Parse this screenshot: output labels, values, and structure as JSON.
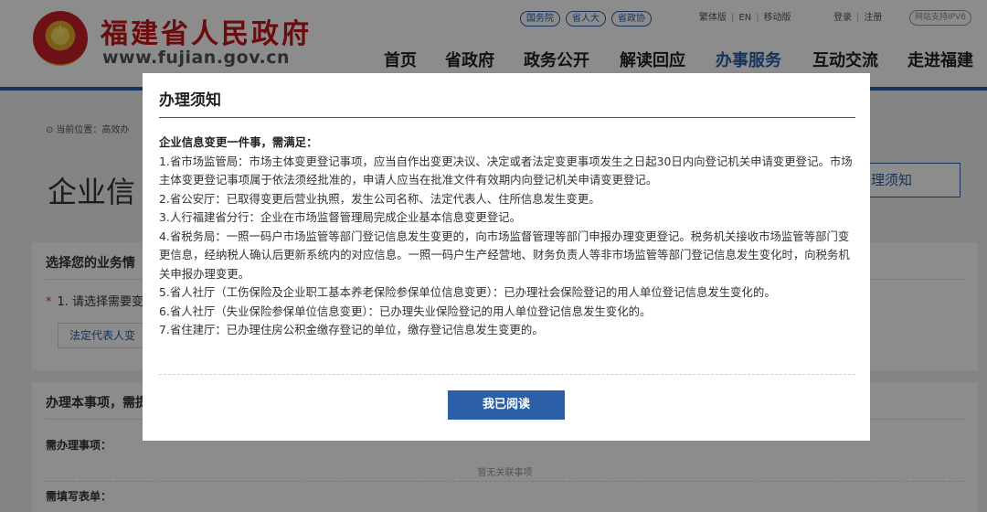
{
  "header": {
    "site_name": "福建省人民政府",
    "site_url": "www.fujian.gov.cn",
    "top_links": [
      "国务院",
      "省人大",
      "省政协"
    ],
    "utility_links": [
      "繁体版",
      "EN",
      "移动版"
    ],
    "account_links": [
      "登录",
      "注册"
    ],
    "ipv6_badge": "网站支持IPV6",
    "nav": [
      "首页",
      "省政府",
      "政务公开",
      "解读回应",
      "办事服务",
      "互动交流",
      "走进福建"
    ],
    "active_nav": "办事服务",
    "brand_color": "#2b5fa8",
    "title_color": "#c4161c"
  },
  "page": {
    "breadcrumb": "当前位置：高效办",
    "title": "企业信",
    "notice_button": "理须知",
    "panel1": {
      "heading": "选择您的业务情",
      "question": "1. 请选择需要变",
      "option": "法定代表人变"
    },
    "panel2": {
      "heading": "办理本事项，需提",
      "items_label": "需办理事项：",
      "empty_text": "暂无关联事项",
      "forms_label": "需填写表单："
    }
  },
  "modal": {
    "title": "办理须知",
    "lead": "企业信息变更一件事，需满足：",
    "items": [
      "1.省市场监管局：市场主体变更登记事项，应当自作出变更决议、决定或者法定变更事项发生之日起30日内向登记机关申请变更登记。市场主体变更登记事项属于依法须经批准的，申请人应当在批准文件有效期内向登记机关申请变更登记。",
      "2.省公安厅：已取得变更后营业执照，发生公司名称、法定代表人、住所信息发生变更。",
      "3.人行福建省分行：企业在市场监督管理局完成企业基本信息变更登记。",
      "4.省税务局：一照一码户市场监管等部门登记信息发生变更的，向市场监督管理等部门申报办理变更登记。税务机关接收市场监管等部门变更信息，经纳税人确认后更新系统内的对应信息。一照一码户生产经营地、财务负责人等非市场监管等部门登记信息发生变化时，向税务机关申报办理变更。",
      "5.省人社厅（工伤保险及企业职工基本养老保险参保单位信息变更）：已办理社会保险登记的用人单位登记信息发生变化的。",
      "6.省人社厅（失业保险参保单位信息变更）：已办理失业保险登记的用人单位登记信息发生变化的。",
      "7.省住建厅：已办理住房公积金缴存登记的单位，缴存登记信息发生变更的。"
    ],
    "confirm_button": "我已阅读"
  }
}
